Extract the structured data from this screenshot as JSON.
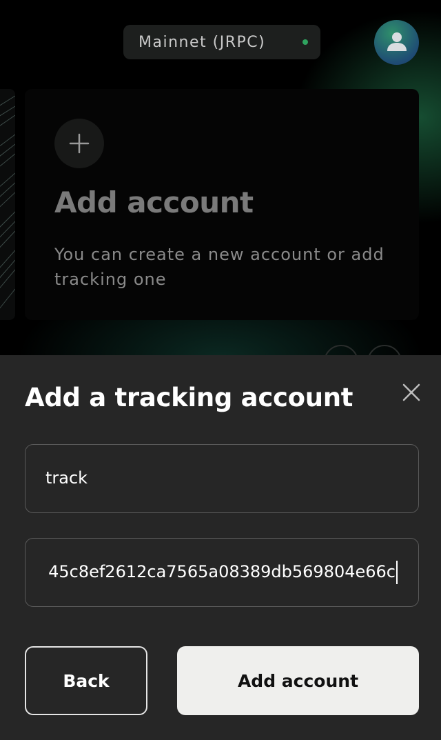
{
  "header": {
    "network_label": "Mainnet (JRPC)",
    "network_status_color": "#2fa35f",
    "avatar_icon": "user-icon"
  },
  "carousel": {
    "add_card": {
      "icon": "plus-icon",
      "title": "Add account",
      "description": "You can create a new account or add tracking one"
    }
  },
  "sheet": {
    "title": "Add a tracking account",
    "close_icon": "close-icon",
    "name_field": {
      "value": "track"
    },
    "address_field": {
      "value": "45c8ef2612ca7565a08389db569804e66c"
    },
    "back_label": "Back",
    "add_label": "Add account"
  },
  "colors": {
    "sheet_bg": "#262626",
    "primary_button_bg": "#efefed",
    "accent_green": "#2fa35f"
  }
}
